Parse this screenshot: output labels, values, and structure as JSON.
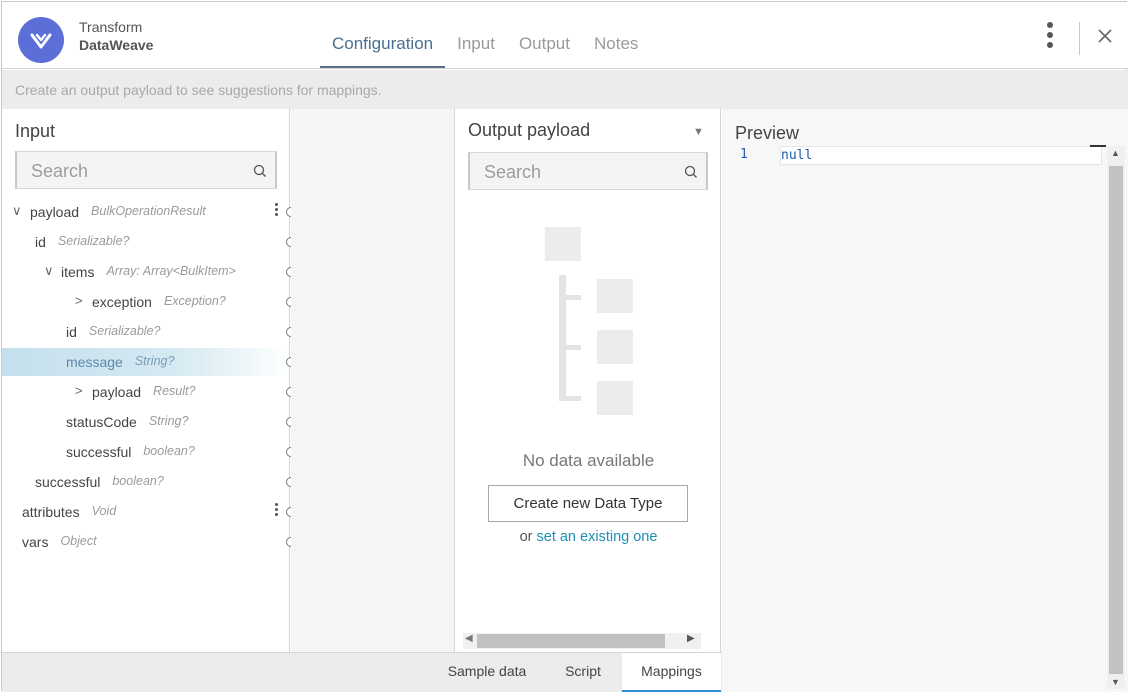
{
  "header": {
    "title_line1": "Transform",
    "title_line2": "DataWeave",
    "tabs": [
      {
        "label": "Configuration",
        "active": true
      },
      {
        "label": "Input",
        "active": false
      },
      {
        "label": "Output",
        "active": false
      },
      {
        "label": "Notes",
        "active": false
      }
    ]
  },
  "infobar": {
    "text": "Create an output payload to see suggestions for mappings."
  },
  "input_panel": {
    "title": "Input",
    "search_placeholder": "Search",
    "tree": [
      {
        "label": "payload",
        "type": "BulkOperationResult",
        "depth": 0,
        "chevron": "expanded",
        "menu": true
      },
      {
        "label": "id",
        "type": "Serializable?",
        "depth": 1,
        "chevron": "none"
      },
      {
        "label": "items",
        "type": "Array: Array<BulkItem>",
        "depth": 1,
        "chevron": "expanded"
      },
      {
        "label": "exception",
        "type": "Exception?",
        "depth": 2,
        "chevron": "collapsed"
      },
      {
        "label": "id",
        "type": "Serializable?",
        "depth": 2,
        "chevron": "none"
      },
      {
        "label": "message",
        "type": "String?",
        "depth": 2,
        "chevron": "none",
        "selected": true
      },
      {
        "label": "payload",
        "type": "Result?",
        "depth": 2,
        "chevron": "collapsed"
      },
      {
        "label": "statusCode",
        "type": "String?",
        "depth": 2,
        "chevron": "none"
      },
      {
        "label": "successful",
        "type": "boolean?",
        "depth": 2,
        "chevron": "none"
      },
      {
        "label": "successful",
        "type": "boolean?",
        "depth": 1,
        "chevron": "none"
      },
      {
        "label": "attributes",
        "type": "Void",
        "depth": 0,
        "chevron": "none",
        "menu": true
      },
      {
        "label": "vars",
        "type": "Object",
        "depth": 0,
        "chevron": "none"
      }
    ]
  },
  "output_panel": {
    "title": "Output payload",
    "search_placeholder": "Search",
    "no_data": "No data available",
    "create_button": "Create new Data Type",
    "or_text": "or",
    "existing_link": "set an existing one"
  },
  "preview": {
    "title": "Preview",
    "lines": [
      {
        "number": "1",
        "code": "null"
      }
    ]
  },
  "bottom_tabs": [
    {
      "label": "Sample data",
      "active": false
    },
    {
      "label": "Script",
      "active": false
    },
    {
      "label": "Mappings",
      "active": true
    }
  ],
  "colors": {
    "logo": "#5c6fd9",
    "active_tab": "#4a6f93",
    "link": "#1f8fb5",
    "selection": "#c4e0ee",
    "bottom_active": "#2b8fd1"
  },
  "icons": {
    "logo": "dataweave-logo-icon",
    "menu": "kebab-menu-icon",
    "close": "close-icon",
    "search": "search-icon"
  }
}
